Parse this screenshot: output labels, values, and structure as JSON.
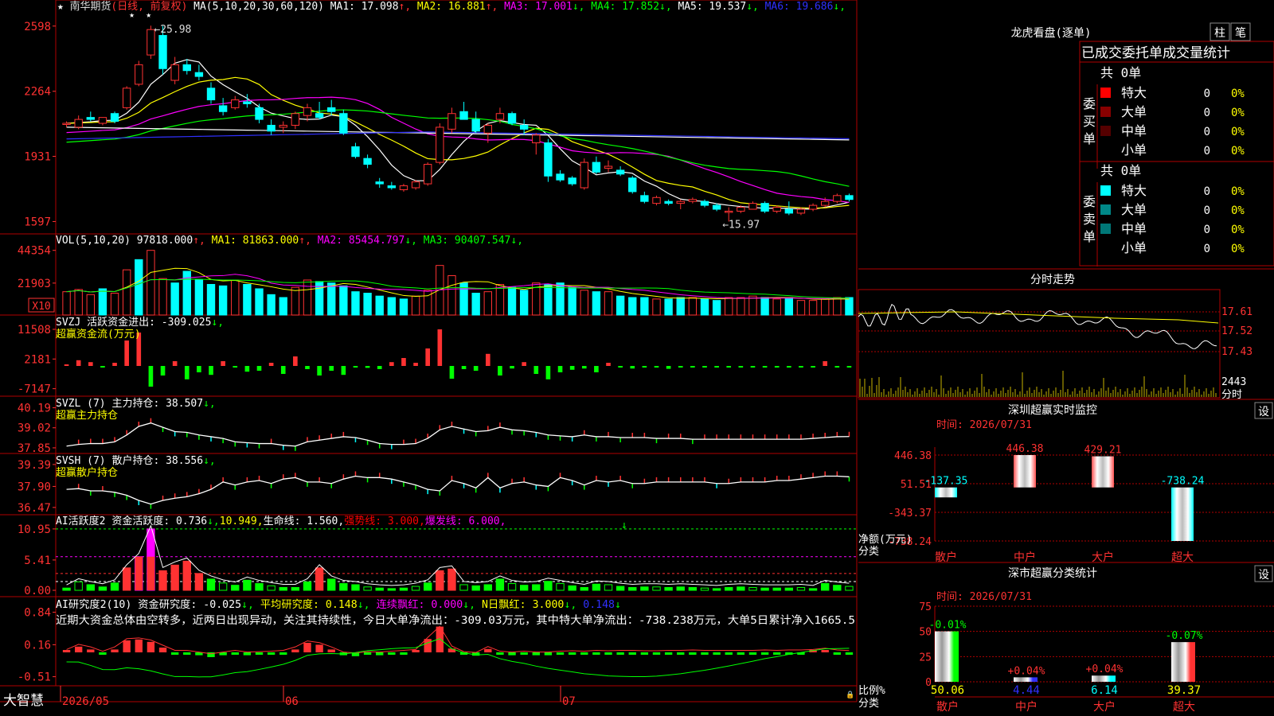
{
  "app": {
    "name": "大智慧"
  },
  "main": {
    "title": "南华期货",
    "period": "(日线, 前复权)",
    "ma_label": "MA(5,10,20,30,60,120)",
    "ma_values": [
      {
        "label": "MA1:",
        "value": "17.098",
        "arrow": "↑",
        "color": "#ffffff"
      },
      {
        "label": "MA2:",
        "value": "16.881",
        "arrow": "↑",
        "color": "#ffff00"
      },
      {
        "label": "MA3:",
        "value": "17.001",
        "arrow": "↓",
        "color": "#ff00ff"
      },
      {
        "label": "MA4:",
        "value": "17.852",
        "arrow": "↓",
        "color": "#00ff00"
      },
      {
        "label": "MA5:",
        "value": "19.537",
        "arrow": "↓",
        "color": "#ffffff"
      },
      {
        "label": "MA6:",
        "value": "19.686",
        "arrow": "↓",
        "color": "#3030ff"
      }
    ],
    "price_axis": [
      "2598",
      "2264",
      "1931",
      "1597"
    ],
    "high_mark": "25.98",
    "low_mark": "15.97"
  },
  "vol": {
    "label": "VOL(5,10,20)",
    "value": "97818.000",
    "ma_values": [
      {
        "label": "MA1:",
        "value": "81863.000",
        "arrow": "↑",
        "color": "#ffff00"
      },
      {
        "label": "MA2:",
        "value": "85454.797",
        "arrow": "↓",
        "color": "#ff00ff"
      },
      {
        "label": "MA3:",
        "value": "90407.547",
        "arrow": "↓",
        "color": "#00ff00"
      }
    ],
    "axis": [
      "44354",
      "21903"
    ],
    "unit": "X10"
  },
  "svzj": {
    "label": "SVZJ",
    "name": "活跃资金进出:",
    "value": "-309.025",
    "arrow": "↓,",
    "sub": "超赢资金流(万元)",
    "axis": [
      "11508",
      "2181",
      "-7147"
    ]
  },
  "svzl": {
    "label": "SVZL (7)",
    "name": "主力持仓:",
    "value": "38.507",
    "arrow": "↓,",
    "sub": "超赢主力持仓",
    "axis": [
      "40.19",
      "39.02",
      "37.85"
    ]
  },
  "svsh": {
    "label": "SVSH (7)",
    "name": "散户持仓:",
    "value": "38.556",
    "arrow": "↓,",
    "sub": "超赢散户持仓",
    "axis": [
      "39.39",
      "37.90",
      "36.47"
    ]
  },
  "ai1": {
    "label": "AI活跃度2",
    "items": [
      {
        "text": "资金活跃度: 0.736",
        "arrow": "↓,",
        "color": "#ffffff"
      },
      {
        "text": "10.949,",
        "arrow": "",
        "color": "#ffff00"
      },
      {
        "text": "生命线: 1.560,",
        "arrow": "",
        "color": "#ffffff"
      },
      {
        "text": "强势线: 3.000,",
        "arrow": "",
        "color": "#ff0000"
      },
      {
        "text": "爆发线: 6.000,",
        "arrow": "",
        "color": "#ff00ff"
      }
    ],
    "axis": [
      "10.95",
      "5.41",
      "0.00"
    ]
  },
  "ai2": {
    "label": "AI研究度2(10)",
    "items": [
      {
        "text": "资金研究度: -0.025",
        "arrow": "↓,",
        "color": "#ffffff"
      },
      {
        "text": "平均研究度: 0.148",
        "arrow": "↓,",
        "color": "#ffff00"
      },
      {
        "text": "连续飘红: 0.000",
        "arrow": "↓,",
        "color": "#ff00ff"
      },
      {
        "text": "N日飘红: 3.000",
        "arrow": "↓,",
        "color": "#ffff00"
      },
      {
        "text": "0.148",
        "arrow": "↓",
        "color": "#3030ff"
      }
    ],
    "comment": "近期大资金总体由空转多，近两日出现异动，关注其持续性，今日大单净流出：-309.03万元，其中特大单净流出：-738.238万元，大单5日累计净入1665.5",
    "axis": [
      "0.84",
      "0.16",
      "-0.51"
    ]
  },
  "dates": [
    "2026/05",
    "06",
    "07"
  ],
  "right": {
    "lhb": {
      "title": "龙虎看盘(逐单)",
      "tabs": [
        "柱",
        "笔"
      ],
      "subtitle": "已成交委托单成交量统计",
      "buy": {
        "side": "委买单",
        "total": "共 0单",
        "rows": [
          {
            "label": "特大",
            "value": "0",
            "pct": "0%",
            "color": "#ff0000"
          },
          {
            "label": "大单",
            "value": "0",
            "pct": "0%",
            "color": "#880000"
          },
          {
            "label": "中单",
            "value": "0",
            "pct": "0%",
            "color": "#550000"
          },
          {
            "label": "小单",
            "value": "0",
            "pct": "0%",
            "color": ""
          }
        ]
      },
      "sell": {
        "side": "委卖单",
        "total": "共 0单",
        "rows": [
          {
            "label": "特大",
            "value": "0",
            "pct": "0%",
            "color": "#00ffff"
          },
          {
            "label": "大单",
            "value": "0",
            "pct": "0%",
            "color": "#008888"
          },
          {
            "label": "中单",
            "value": "0",
            "pct": "0%",
            "color": "#007777"
          },
          {
            "label": "小单",
            "value": "0",
            "pct": "0%",
            "color": ""
          }
        ]
      }
    },
    "fenshi": {
      "title": "分时走势",
      "axis": [
        "17.61",
        "17.52",
        "17.43"
      ],
      "vol_axis": "2443",
      "vol_label": "分时"
    },
    "monitor": {
      "title": "深圳超赢实时监控",
      "set_label": "设",
      "time": "时间: 2026/07/31",
      "axis": [
        "446.38",
        "51.51",
        "-343.37",
        "-738.24"
      ],
      "unit_label": "净额(万元)",
      "cat_label": "分类",
      "categories": [
        "散户",
        "中户",
        "大户",
        "超大"
      ],
      "values": [
        -137.35,
        446.38,
        429.21,
        -738.24
      ],
      "value_labels": [
        "-137.35",
        "446.38",
        "429.21",
        "-738.24"
      ]
    },
    "fenlei": {
      "title": "深市超赢分类统计",
      "set_label": "设",
      "time": "时间: 2026/07/31",
      "axis": [
        "75",
        "50",
        "25",
        "0"
      ],
      "ratio_label": "比例%",
      "cat_label": "分类",
      "categories": [
        "散户",
        "中户",
        "大户",
        "超大"
      ],
      "values": [
        50.06,
        4.44,
        6.14,
        39.37
      ],
      "value_labels": [
        "50.06",
        "4.44",
        "6.14",
        "39.37"
      ],
      "change_labels": [
        "-0.01%",
        "+0.04%",
        "+0.04%",
        "-0.07%"
      ]
    }
  },
  "chart_data": [
    {
      "type": "candlestick",
      "title": "南华期货",
      "ylim": [
        15.5,
        26.5
      ],
      "ohlc": [
        [
          21.0,
          21.1,
          20.8,
          21.0
        ],
        [
          20.8,
          21.4,
          20.7,
          21.2
        ],
        [
          21.3,
          21.6,
          21.1,
          21.2
        ],
        [
          21.0,
          21.3,
          20.9,
          21.3
        ],
        [
          21.5,
          21.6,
          21.0,
          21.1
        ],
        [
          21.8,
          22.9,
          21.7,
          22.8
        ],
        [
          23.0,
          24.2,
          22.9,
          24.0
        ],
        [
          24.5,
          26.0,
          24.3,
          25.8
        ],
        [
          25.5,
          25.98,
          23.5,
          23.8
        ],
        [
          23.2,
          24.4,
          23.0,
          24.0
        ],
        [
          24.0,
          24.3,
          23.5,
          23.7
        ],
        [
          23.6,
          24.0,
          23.2,
          23.4
        ],
        [
          22.8,
          23.1,
          22.0,
          22.2
        ],
        [
          21.9,
          22.3,
          21.4,
          21.6
        ],
        [
          21.8,
          22.4,
          21.7,
          22.2
        ],
        [
          22.1,
          22.5,
          21.8,
          22.0
        ],
        [
          21.8,
          22.0,
          21.0,
          21.2
        ],
        [
          20.9,
          21.2,
          20.4,
          20.6
        ],
        [
          20.8,
          21.1,
          20.5,
          20.9
        ],
        [
          20.9,
          21.6,
          20.7,
          21.5
        ],
        [
          21.4,
          22.0,
          21.1,
          21.8
        ],
        [
          21.5,
          22.1,
          21.2,
          21.3
        ],
        [
          21.8,
          22.2,
          21.4,
          21.6
        ],
        [
          21.5,
          21.7,
          20.4,
          20.5
        ],
        [
          19.8,
          20.0,
          19.2,
          19.3
        ],
        [
          19.2,
          19.4,
          18.7,
          18.9
        ],
        [
          18.0,
          18.2,
          17.7,
          17.9
        ],
        [
          17.8,
          18.0,
          17.6,
          17.7
        ],
        [
          17.6,
          17.9,
          17.5,
          17.8
        ],
        [
          17.7,
          18.1,
          17.6,
          18.0
        ],
        [
          17.9,
          19.0,
          17.8,
          18.9
        ],
        [
          19.0,
          21.0,
          18.9,
          20.8
        ],
        [
          20.7,
          21.8,
          20.5,
          21.5
        ],
        [
          21.6,
          22.1,
          21.3,
          21.2
        ],
        [
          21.2,
          21.6,
          20.5,
          20.6
        ],
        [
          20.5,
          21.0,
          20.0,
          20.9
        ],
        [
          21.2,
          21.8,
          21.0,
          21.5
        ],
        [
          21.5,
          21.6,
          20.9,
          21.0
        ],
        [
          20.9,
          21.2,
          20.4,
          20.7
        ],
        [
          20.0,
          20.5,
          19.4,
          20.4
        ],
        [
          20.0,
          20.2,
          18.0,
          18.3
        ],
        [
          18.4,
          18.6,
          18.0,
          18.1
        ],
        [
          18.2,
          18.3,
          17.8,
          17.9
        ],
        [
          17.7,
          19.2,
          17.6,
          19.0
        ],
        [
          19.0,
          19.3,
          18.4,
          18.5
        ],
        [
          18.7,
          19.1,
          18.5,
          18.8
        ],
        [
          18.6,
          18.8,
          18.3,
          18.4
        ],
        [
          18.2,
          18.3,
          17.4,
          17.5
        ],
        [
          17.3,
          17.5,
          16.9,
          17.0
        ],
        [
          16.9,
          17.3,
          16.8,
          17.2
        ],
        [
          17.0,
          17.1,
          16.8,
          16.9
        ],
        [
          16.9,
          17.1,
          16.6,
          17.0
        ],
        [
          17.0,
          17.2,
          16.9,
          17.1
        ],
        [
          17.0,
          17.1,
          16.7,
          16.8
        ],
        [
          16.8,
          16.9,
          16.5,
          16.6
        ],
        [
          16.5,
          16.7,
          15.97,
          16.5
        ],
        [
          16.5,
          16.8,
          16.4,
          16.7
        ],
        [
          16.6,
          17.0,
          16.6,
          16.9
        ],
        [
          16.9,
          17.0,
          16.4,
          16.5
        ],
        [
          16.5,
          16.8,
          16.4,
          16.7
        ],
        [
          16.6,
          17.0,
          16.3,
          16.4
        ],
        [
          16.4,
          16.7,
          16.3,
          16.6
        ],
        [
          16.6,
          16.9,
          16.5,
          16.8
        ],
        [
          16.8,
          17.2,
          16.7,
          17.0
        ],
        [
          17.0,
          17.4,
          16.9,
          17.3
        ],
        [
          17.3,
          17.4,
          17.0,
          17.1
        ]
      ]
    },
    {
      "type": "bar",
      "name": "VOL",
      "ylim": [
        0,
        48000
      ],
      "unit": "X10",
      "values": [
        16000,
        17500,
        14000,
        18000,
        15000,
        31000,
        38000,
        44354,
        25000,
        22000,
        30000,
        24000,
        21000,
        20000,
        24000,
        21000,
        18000,
        14000,
        12000,
        19000,
        24000,
        23000,
        22000,
        20000,
        16000,
        15000,
        13000,
        12000,
        11000,
        13000,
        17000,
        34000,
        27000,
        22000,
        15000,
        16000,
        21000,
        19000,
        17000,
        22000,
        21000,
        22000,
        19000,
        17000,
        16000,
        16000,
        13000,
        12000,
        12000,
        11000,
        11000,
        12000,
        12000,
        11000,
        10000,
        12000,
        12000,
        13000,
        12000,
        11000,
        12000,
        10000,
        10000,
        11000,
        12000,
        12000
      ],
      "colors": [
        "r",
        "r",
        "r",
        "c",
        "r",
        "r",
        "c",
        "r",
        "r",
        "c",
        "c",
        "c",
        "c",
        "c",
        "r",
        "c",
        "c",
        "c",
        "c",
        "r",
        "r",
        "c",
        "c",
        "c",
        "c",
        "c",
        "c",
        "c",
        "c",
        "r",
        "r",
        "r",
        "r",
        "c",
        "c",
        "r",
        "r",
        "c",
        "c",
        "r",
        "c",
        "c",
        "c",
        "r",
        "c",
        "r",
        "c",
        "c",
        "c",
        "r",
        "c",
        "c",
        "r",
        "c",
        "c",
        "r",
        "r",
        "r",
        "c",
        "r",
        "c",
        "r",
        "r",
        "r",
        "r",
        "c"
      ]
    },
    {
      "type": "bar",
      "name": "SVZJ",
      "ylim": [
        -8000,
        12000
      ],
      "values": [
        0,
        1800,
        1200,
        -500,
        1000,
        8000,
        10500,
        -6500,
        -3000,
        1500,
        -4200,
        -2000,
        -2800,
        1500,
        -300,
        -1800,
        -1500,
        1000,
        -2500,
        3000,
        -1000,
        -3000,
        -1500,
        -2800,
        -300,
        -600,
        -1000,
        1200,
        2500,
        1000,
        5500,
        11508,
        -4000,
        -1000,
        -1500,
        3800,
        -3000,
        -800,
        1200,
        -2500,
        -4200,
        -2000,
        -1200,
        -800,
        -2000,
        1000,
        -300,
        -800,
        -500,
        -300,
        -900,
        -400,
        -300,
        -200,
        -300,
        -200,
        -300,
        -300,
        -200,
        -500,
        -300,
        -200,
        -100,
        1500,
        -400,
        -200
      ]
    },
    {
      "type": "line",
      "name": "SVZL",
      "ylim": [
        37.8,
        40.4
      ],
      "values": [
        37.95,
        38.05,
        38.1,
        38.1,
        38.2,
        38.6,
        39.1,
        39.3,
        39.05,
        38.8,
        38.75,
        38.6,
        38.5,
        38.4,
        38.2,
        38.15,
        38.1,
        38.1,
        38.0,
        37.95,
        38.2,
        38.3,
        38.4,
        38.5,
        38.45,
        38.3,
        38.1,
        38.05,
        38.05,
        38.1,
        38.4,
        38.9,
        39.1,
        38.95,
        38.8,
        38.85,
        39.05,
        38.9,
        38.85,
        38.75,
        38.6,
        38.55,
        38.5,
        38.6,
        38.5,
        38.5,
        38.45,
        38.45,
        38.45,
        38.4,
        38.4,
        38.4,
        38.35,
        38.35,
        38.35,
        38.35,
        38.35,
        38.35,
        38.35,
        38.35,
        38.35,
        38.35,
        38.4,
        38.45,
        38.5,
        38.507
      ]
    },
    {
      "type": "line",
      "name": "SVSH",
      "ylim": [
        36.3,
        39.6
      ],
      "values": [
        37.7,
        37.75,
        37.6,
        37.6,
        37.5,
        37.3,
        36.95,
        36.7,
        36.95,
        37.1,
        37.2,
        37.4,
        37.7,
        38.2,
        38.0,
        38.2,
        38.3,
        38.1,
        38.4,
        38.5,
        38.2,
        38.2,
        38.1,
        38.4,
        38.6,
        38.5,
        38.5,
        38.4,
        38.2,
        38.0,
        37.7,
        37.6,
        38.3,
        38.1,
        37.8,
        38.5,
        37.8,
        38.1,
        38.2,
        38.0,
        37.9,
        38.5,
        38.3,
        38.0,
        38.3,
        38.2,
        38.3,
        38.1,
        38.1,
        38.2,
        38.2,
        38.2,
        38.2,
        38.2,
        38.1,
        38.1,
        38.2,
        38.2,
        38.2,
        38.3,
        38.3,
        38.4,
        38.5,
        38.6,
        38.6,
        38.556
      ]
    },
    {
      "type": "bar",
      "name": "AI活跃度2",
      "ylim": [
        0,
        11.5
      ],
      "values": [
        0.4,
        1.5,
        1.0,
        0.6,
        1.3,
        4.0,
        6.0,
        10.95,
        3.5,
        4.5,
        5.2,
        3.0,
        2.0,
        1.3,
        0.9,
        1.8,
        1.2,
        0.8,
        0.5,
        0.5,
        1.5,
        4.0,
        2.0,
        1.2,
        1.0,
        0.6,
        0.4,
        0.3,
        0.4,
        0.7,
        1.3,
        3.5,
        3.8,
        1.0,
        0.8,
        1.0,
        2.0,
        1.2,
        0.9,
        1.0,
        1.6,
        1.2,
        0.8,
        0.5,
        1.1,
        1.0,
        0.7,
        0.5,
        0.6,
        0.6,
        0.5,
        0.6,
        0.5,
        0.4,
        0.3,
        0.5,
        0.6,
        0.5,
        0.4,
        0.4,
        0.4,
        0.5,
        0.3,
        1.2,
        0.9,
        0.7
      ]
    },
    {
      "type": "bar",
      "name": "AI研究度2(10)",
      "ylim": [
        -0.6,
        0.9
      ],
      "values": [
        0.0,
        0.12,
        0.06,
        -0.04,
        0.06,
        0.25,
        0.27,
        0.22,
        0.1,
        -0.02,
        -0.02,
        -0.06,
        -0.1,
        -0.06,
        -0.02,
        -0.06,
        -0.05,
        -0.04,
        -0.02,
        0.06,
        0.2,
        0.16,
        0.06,
        -0.06,
        -0.08,
        -0.05,
        -0.06,
        -0.04,
        -0.02,
        0.0,
        0.28,
        0.54,
        0.08,
        -0.05,
        -0.07,
        0.07,
        -0.04,
        -0.06,
        -0.04,
        -0.06,
        -0.06,
        -0.04,
        -0.03,
        -0.04,
        -0.02,
        -0.03,
        -0.02,
        -0.02,
        -0.03,
        -0.03,
        -0.02,
        -0.02,
        -0.01,
        -0.02,
        -0.02,
        -0.02,
        -0.02,
        -0.02,
        -0.01,
        -0.02,
        -0.01,
        -0.01,
        0.0,
        0.03,
        -0.01,
        -0.025
      ]
    }
  ]
}
